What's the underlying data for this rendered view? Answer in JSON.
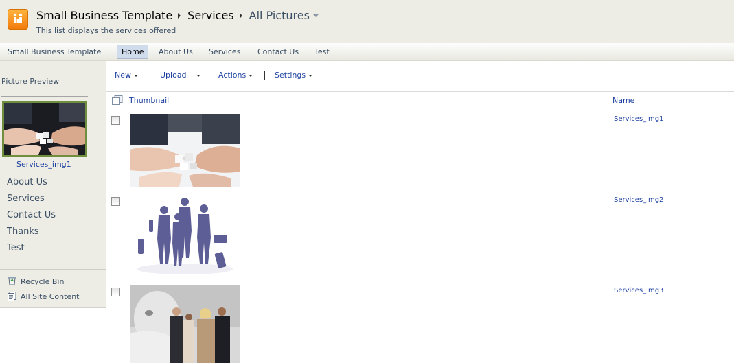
{
  "header": {
    "breadcrumb": [
      "Small Business Template",
      "Services",
      "All Pictures"
    ],
    "subtitle": "This list displays the services offered"
  },
  "topnav": {
    "tabs": [
      "Small Business Template",
      "Home",
      "About Us",
      "Services",
      "Contact Us",
      "Test"
    ],
    "selected": "Home"
  },
  "leftnav": {
    "preview_title": "Picture Preview",
    "preview_caption": "Services_img1",
    "items": [
      "About Us",
      "Services",
      "Contact Us",
      "Thanks",
      "Test"
    ],
    "utility": [
      "Recycle Bin",
      "All Site Content"
    ]
  },
  "toolbar": {
    "new": "New",
    "upload": "Upload",
    "actions": "Actions",
    "settings": "Settings"
  },
  "list": {
    "columns": [
      "Thumbnail",
      "Name"
    ],
    "rows": [
      {
        "name": "Services_img1",
        "thumbnail": "puzzle-hands-image"
      },
      {
        "name": "Services_img2",
        "thumbnail": "team-figures-image"
      },
      {
        "name": "Services_img3",
        "thumbnail": "business-people-image"
      }
    ]
  },
  "colors": {
    "link": "#1B3FA0",
    "chrome_bg": "#EEEDE5",
    "selected_tab": "#D0DCEB",
    "preview_border": "#6F8F3E"
  }
}
